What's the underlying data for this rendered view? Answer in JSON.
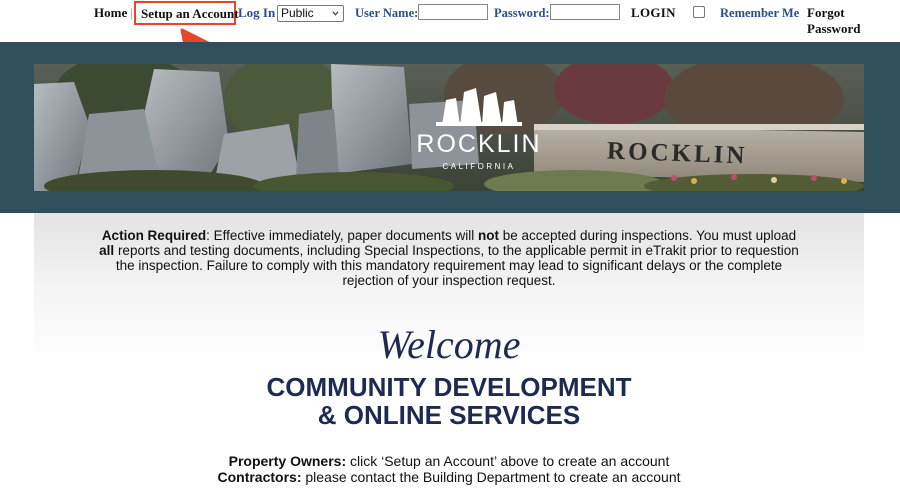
{
  "nav": {
    "home": "Home",
    "separator": "|",
    "setup_account": "Setup an Account",
    "log_in": "Log In",
    "role_select": {
      "value": "Public"
    },
    "username_label": "User Name:",
    "password_label": "Password:",
    "login_button": "LOGIN",
    "remember_me": "Remember Me",
    "forgot_password": "Forgot Password"
  },
  "annotation": {
    "highlight_color": "#e8462a",
    "arrow_color": "#e8462a"
  },
  "banner": {
    "logo_word": "ROCKLIN",
    "logo_sub": "CALIFORNIA",
    "wall_word": "ROCKLIN",
    "band_color": "#2f4f5c"
  },
  "notice": {
    "bold_lead": "Action Required",
    "t1": ": Effective immediately, paper documents will ",
    "bold_not": "not",
    "t2": " be accepted during inspections. You must upload ",
    "bold_all": "all",
    "t3": " reports and testing documents, including Special Inspections, to the applicable permit in eTrakit prior to requestion the inspection. Failure to comply with this mandatory requirement may lead to significant delays or the complete rejection of your inspection request."
  },
  "welcome": "Welcome",
  "heading": {
    "line1": "COMMUNITY DEVELOPMENT",
    "line2": "& ONLINE SERVICES"
  },
  "info": {
    "owners_label": "Property Owners:",
    "owners_text": " click ‘Setup an Account’ above to create an account",
    "contractors_label": "Contractors:",
    "contractors_text": " please contact the Building Department to create an account"
  },
  "colors": {
    "heading": "#1d2a52",
    "link": "#2b4e8c"
  }
}
